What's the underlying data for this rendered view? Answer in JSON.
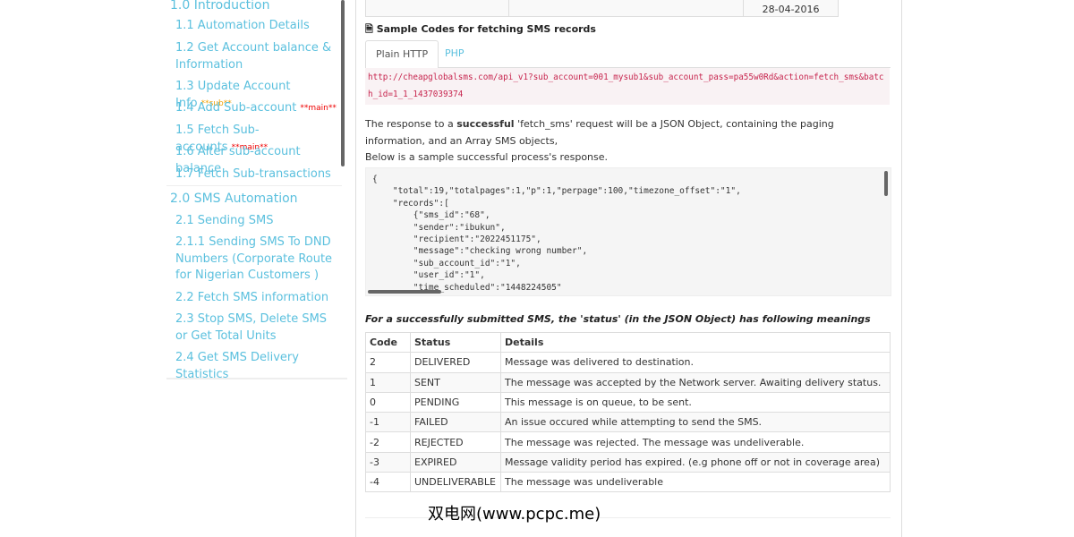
{
  "sidebar": {
    "items": [
      {
        "label": "1.0 Introduction"
      },
      {
        "label": "1.1 Automation Details"
      },
      {
        "label": "1.2 Get Account balance & Information"
      },
      {
        "label": "1.3 Update Account Info",
        "tag": "**sub**"
      },
      {
        "label": "1.4 Add Sub-account",
        "tag": "**main**"
      },
      {
        "label": "1.5 Fetch Sub-accounts",
        "tag": "**main**"
      },
      {
        "label": "1.6 Alter sub-account balance"
      },
      {
        "label": "1.7 Fetch Sub-transactions"
      },
      {
        "label": "2.0 SMS Automation"
      },
      {
        "label": "2.1 Sending SMS"
      },
      {
        "label": "2.1.1 Sending SMS To DND Numbers (Corporate Route for Nigerian Customers )"
      },
      {
        "label": "2.2 Fetch SMS information"
      },
      {
        "label": "2.3 Stop SMS, Delete SMS or Get Total Units"
      },
      {
        "label": "2.4 Get SMS Delivery Statistics"
      }
    ]
  },
  "top_table": {
    "date": "28-04-2016"
  },
  "section_title": "Sample Codes for fetching SMS records",
  "tabs": [
    "Plain HTTP",
    "PHP"
  ],
  "url": "http://cheapglobalsms.com/api_v1?sub_account=001_mysub1&sub_account_pass=pa55w0Rd&action=fetch_sms&batch_id=1_1_1437039374",
  "para1_pre": "The response to a ",
  "para1_bold": "successful",
  "para1_post": " 'fetch_sms' request will be a JSON Object, containing the paging information, and an Array SMS objects,",
  "para2": "Below is a sample successful process's response.",
  "code": "{\n    \"total\":19,\"totalpages\":1,\"p\":1,\"perpage\":100,\"timezone_offset\":\"1\",\n    \"records\":[\n        {\"sms_id\":\"68\",\n        \"sender\":\"ibukun\",\n        \"recipient\":\"2022451175\",\n        \"message\":\"checking wrong number\",\n        \"sub_account_id\":\"1\",\n        \"user_id\":\"1\",\n        \"time_scheduled\":\"1448224505\"",
  "caption": "For a successfully submitted SMS, the 'status' (in the JSON Object) has following meanings",
  "status_table": {
    "headers": [
      "Code",
      "Status",
      "Details"
    ],
    "rows": [
      [
        "2",
        "DELIVERED",
        "Message was delivered to destination."
      ],
      [
        "1",
        "SENT",
        "The message was accepted by the Network server. Awaiting delivery status."
      ],
      [
        "0",
        "PENDING",
        "This message is on queue, to be sent."
      ],
      [
        "-1",
        "FAILED",
        "An issue occured while attempting to send the SMS."
      ],
      [
        "-2",
        "REJECTED",
        "The message was rejected. The message was undeliverable."
      ],
      [
        "-3",
        "EXPIRED",
        "Message validity period has expired. (e.g phone off or not in coverage area)"
      ],
      [
        "-4",
        "UNDELIVERABLE",
        "The message was undeliverable"
      ]
    ]
  },
  "watermark": "双电网(www.pcpc.me)"
}
